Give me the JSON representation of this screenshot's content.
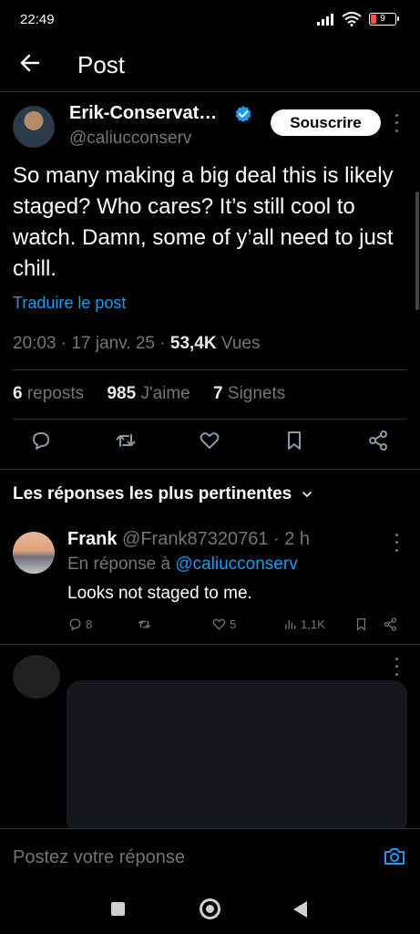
{
  "status_bar": {
    "time": "22:49",
    "battery": "9"
  },
  "header": {
    "title": "Post"
  },
  "post": {
    "author_name": "Erik-Conservat…",
    "handle": "@caliucconserv",
    "subscribe_label": "Souscrire",
    "text": "So many making a big deal this is likely staged? Who cares? It’s still cool to watch. Damn, some of y’all need to just chill.",
    "translate_label": "Traduire le post",
    "time": "20:03",
    "date": "17 janv. 25",
    "views_count": "53,4K",
    "views_label": "Vues",
    "reposts_count": "6",
    "reposts_label": "reposts",
    "likes_count": "985",
    "likes_label": "J'aime",
    "bookmarks_count": "7",
    "bookmarks_label": "Signets"
  },
  "replies_section": {
    "title": "Les réponses les plus pertinentes"
  },
  "reply": {
    "name": "Frank",
    "handle": "@Frank87320761",
    "age": "2 h",
    "in_reply_prefix": "En réponse à",
    "in_reply_handle": "@caliucconserv",
    "text": "Looks not staged to me.",
    "reply_count": "8",
    "like_count": "5",
    "view_count": "1,1K"
  },
  "composer": {
    "placeholder": "Postez votre réponse"
  },
  "colors": {
    "background": "#000000",
    "accent": "#1d9bf0",
    "muted": "#71767b",
    "text": "#e7e9ea"
  }
}
